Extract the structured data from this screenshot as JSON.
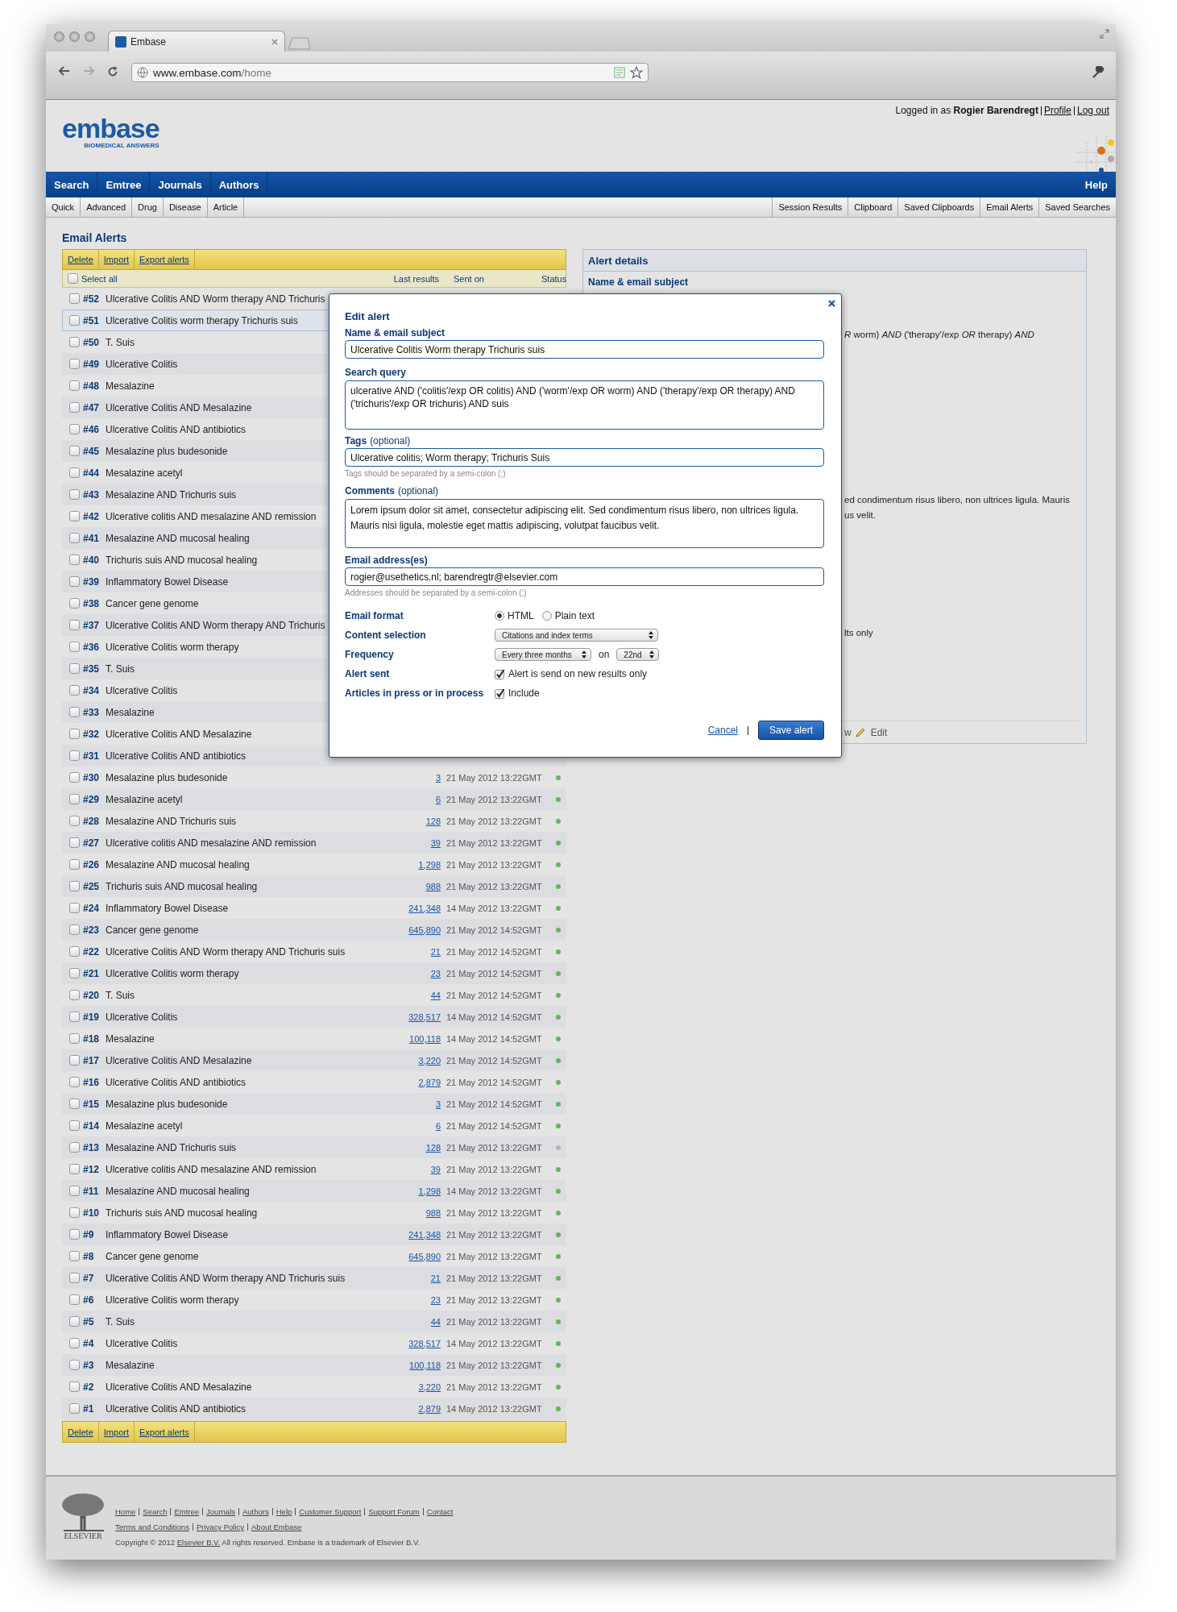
{
  "browser": {
    "tab_title": "Embase",
    "url_host": "www.embase.com",
    "url_path": "/home"
  },
  "header": {
    "logo": "embase",
    "tagline": "BIOMEDICAL ANSWERS",
    "login_text": "Logged in as **Rogier Barendregt**",
    "user_links": [
      "Profile",
      "Log out"
    ]
  },
  "nav": {
    "items": [
      "Search",
      "Emtree",
      "Journals",
      "Authors"
    ],
    "help": "Help"
  },
  "subnav": {
    "left": [
      "Quick",
      "Advanced",
      "Drug",
      "Disease",
      "Article"
    ],
    "right": [
      "Session Results",
      "Clipboard",
      "Saved Clipboards",
      "Email Alerts",
      "Saved Searches"
    ]
  },
  "page_title": "Email Alerts",
  "toolbar": [
    "Delete",
    "Import",
    "Export alerts"
  ],
  "list_header": {
    "select_all": "Select all",
    "checked": false,
    "columns": [
      "Last results",
      "Sent on",
      "Status"
    ]
  },
  "alerts": [
    {
      "num": "#52",
      "title": "Ulcerative Colitis AND Worm therapy AND Trichuris",
      "selected": false
    },
    {
      "num": "#51",
      "title": "Ulcerative Colitis worm therapy Trichuris suis",
      "selected": true
    },
    {
      "num": "#50",
      "title": "T. Suis",
      "selected": false
    },
    {
      "num": "#49",
      "title": "Ulcerative Colitis",
      "selected": false
    },
    {
      "num": "#48",
      "title": "Mesalazine",
      "selected": false
    },
    {
      "num": "#47",
      "title": "Ulcerative Colitis AND Mesalazine",
      "selected": false
    },
    {
      "num": "#46",
      "title": "Ulcerative Colitis AND antibiotics",
      "selected": false
    },
    {
      "num": "#45",
      "title": "Mesalazine plus budesonide",
      "selected": false
    },
    {
      "num": "#44",
      "title": "Mesalazine acetyl",
      "selected": false
    },
    {
      "num": "#43",
      "title": "Mesalazine AND Trichuris suis",
      "selected": false
    },
    {
      "num": "#42",
      "title": "Ulcerative colitis AND mesalazine AND remission",
      "selected": false
    },
    {
      "num": "#41",
      "title": "Mesalazine AND mucosal healing",
      "selected": false
    },
    {
      "num": "#40",
      "title": "Trichuris suis AND mucosal healing",
      "selected": false
    },
    {
      "num": "#39",
      "title": "Inflammatory Bowel Disease",
      "selected": false
    },
    {
      "num": "#38",
      "title": "Cancer gene genome",
      "selected": false
    },
    {
      "num": "#37",
      "title": "Ulcerative Colitis AND Worm therapy AND Trichuris",
      "selected": false
    },
    {
      "num": "#36",
      "title": "Ulcerative Colitis worm therapy",
      "selected": false
    },
    {
      "num": "#35",
      "title": "T. Suis",
      "selected": false
    },
    {
      "num": "#34",
      "title": "Ulcerative Colitis",
      "selected": false
    },
    {
      "num": "#33",
      "title": "Mesalazine",
      "selected": false
    },
    {
      "num": "#32",
      "title": "Ulcerative Colitis AND Mesalazine",
      "selected": false
    },
    {
      "num": "#31",
      "title": "Ulcerative Colitis AND antibiotics",
      "selected": false
    },
    {
      "num": "#30",
      "title": "Mesalazine plus budesonide",
      "selected": false,
      "results": "3",
      "sent": "21 May 2012 13:22GMT",
      "active": true
    },
    {
      "num": "#29",
      "title": "Mesalazine acetyl",
      "selected": false,
      "results": "6",
      "sent": "21 May 2012 13:22GMT",
      "active": true
    },
    {
      "num": "#28",
      "title": "Mesalazine AND Trichuris suis",
      "selected": false,
      "results": "128",
      "sent": "21 May 2012 13:22GMT",
      "active": true
    },
    {
      "num": "#27",
      "title": "Ulcerative colitis AND mesalazine AND remission",
      "selected": false,
      "results": "39",
      "sent": "21 May 2012 13:22GMT",
      "active": true
    },
    {
      "num": "#26",
      "title": "Mesalazine AND mucosal healing",
      "selected": false,
      "results": "1,298",
      "sent": "21 May 2012 13:22GMT",
      "active": true
    },
    {
      "num": "#25",
      "title": "Trichuris suis AND mucosal healing",
      "selected": false,
      "results": "988",
      "sent": "21 May 2012 13:22GMT",
      "active": true
    },
    {
      "num": "#24",
      "title": "Inflammatory Bowel Disease",
      "selected": false,
      "results": "241,348",
      "sent": "14 May 2012 13:22GMT",
      "active": true
    },
    {
      "num": "#23",
      "title": "Cancer gene genome",
      "selected": false,
      "results": "645,890",
      "sent": "21 May 2012 14:52GMT",
      "active": true
    },
    {
      "num": "#22",
      "title": "Ulcerative Colitis AND Worm therapy AND Trichuris suis",
      "selected": false,
      "results": "21",
      "sent": "21 May 2012 14:52GMT",
      "active": true
    },
    {
      "num": "#21",
      "title": "Ulcerative Colitis worm therapy",
      "selected": false,
      "results": "23",
      "sent": "21 May 2012 14:52GMT",
      "active": true
    },
    {
      "num": "#20",
      "title": "T. Suis",
      "selected": false,
      "results": "44",
      "sent": "21 May 2012 14:52GMT",
      "active": true
    },
    {
      "num": "#19",
      "title": "Ulcerative Colitis",
      "selected": false,
      "results": "328,517",
      "sent": "14 May 2012 14:52GMT",
      "active": true
    },
    {
      "num": "#18",
      "title": "Mesalazine",
      "selected": false,
      "results": "100,118",
      "sent": "14 May 2012 14:52GMT",
      "active": true
    },
    {
      "num": "#17",
      "title": "Ulcerative Colitis AND Mesalazine",
      "selected": false,
      "results": "3,220",
      "sent": "21 May 2012 14:52GMT",
      "active": true
    },
    {
      "num": "#16",
      "title": "Ulcerative Colitis AND antibiotics",
      "selected": false,
      "results": "2,879",
      "sent": "21 May 2012 14:52GMT",
      "active": true
    },
    {
      "num": "#15",
      "title": "Mesalazine plus budesonide",
      "selected": false,
      "results": "3",
      "sent": "21 May 2012 14:52GMT",
      "active": true
    },
    {
      "num": "#14",
      "title": "Mesalazine acetyl",
      "selected": false,
      "results": "6",
      "sent": "21 May 2012 14:52GMT",
      "active": true
    },
    {
      "num": "#13",
      "title": "Mesalazine AND Trichuris suis",
      "selected": false,
      "results": "128",
      "sent": "21 May 2012 13:22GMT",
      "active": false
    },
    {
      "num": "#12",
      "title": "Ulcerative colitis AND mesalazine AND remission",
      "selected": false,
      "results": "39",
      "sent": "21 May 2012 13:22GMT",
      "active": true
    },
    {
      "num": "#11",
      "title": "Mesalazine AND mucosal healing",
      "selected": false,
      "results": "1,298",
      "sent": "14 May 2012 13:22GMT",
      "active": true
    },
    {
      "num": "#10",
      "title": "Trichuris suis AND mucosal healing",
      "selected": false,
      "results": "988",
      "sent": "21 May 2012 13:22GMT",
      "active": true
    },
    {
      "num": "#9",
      "title": "Inflammatory Bowel Disease",
      "selected": false,
      "results": "241,348",
      "sent": "21 May 2012 13:22GMT",
      "active": true
    },
    {
      "num": "#8",
      "title": "Cancer gene genome",
      "selected": false,
      "results": "645,890",
      "sent": "21 May 2012 13:22GMT",
      "active": true
    },
    {
      "num": "#7",
      "title": "Ulcerative Colitis AND Worm therapy AND Trichuris suis",
      "selected": false,
      "results": "21",
      "sent": "21 May 2012 13:22GMT",
      "active": true
    },
    {
      "num": "#6",
      "title": "Ulcerative Colitis worm therapy",
      "selected": false,
      "results": "23",
      "sent": "21 May 2012 13:22GMT",
      "active": true
    },
    {
      "num": "#5",
      "title": "T. Suis",
      "selected": false,
      "results": "44",
      "sent": "21 May 2012 13:22GMT",
      "active": true
    },
    {
      "num": "#4",
      "title": "Ulcerative Colitis",
      "selected": false,
      "results": "328,517",
      "sent": "14 May 2012 13:22GMT",
      "active": true
    },
    {
      "num": "#3",
      "title": "Mesalazine",
      "selected": false,
      "results": "100,118",
      "sent": "21 May 2012 13:22GMT",
      "active": true
    },
    {
      "num": "#2",
      "title": "Ulcerative Colitis AND Mesalazine",
      "selected": false,
      "results": "3,220",
      "sent": "21 May 2012 13:22GMT",
      "active": true
    },
    {
      "num": "#1",
      "title": "Ulcerative Colitis AND antibiotics",
      "selected": false,
      "results": "2,879",
      "sent": "14 May 2012 13:22GMT",
      "active": true
    }
  ],
  "bottom_toolbar": [
    "Delete",
    "Import",
    "Export alerts"
  ],
  "details": {
    "title": "Alert details",
    "name_label": "Name & email subject",
    "query_fragment": "*R* worm) *AND* ('therapy'/exp *OR* therapy) *AND*",
    "comment_fragments": [
      "ed condimentum risus libero, non ultrices ligula. Mauris",
      "us velit."
    ],
    "alert_fragment": "lts only",
    "preview_fragment": "w",
    "edit_link": "Edit"
  },
  "modal": {
    "title": "Edit alert",
    "fields": [
      {
        "label": "Name & email subject",
        "kind": "input",
        "value": "Ulcerative Colitis Worm therapy Trichuris suis"
      },
      {
        "label": "Search query",
        "kind": "textarea",
        "value": "ulcerative AND ('colitis'/exp OR colitis) AND ('worm'/exp OR worm) AND ('therapy'/exp OR therapy) AND ('trichuris'/exp OR trichuris) AND suis"
      },
      {
        "label": "Tags",
        "optional": "(optional)",
        "kind": "input",
        "value": "Ulcerative colitis; Worm therapy; Trichuris Suis",
        "help": "Tags should be separated by a semi-colon (;)"
      },
      {
        "label": "Comments",
        "optional": "(optional)",
        "kind": "textarea",
        "value": "Lorem ipsum dolor sit amet, consectetur adipiscing elit. Sed condimentum risus libero, non ultrices ligula. Mauris nisi ligula, molestie eget mattis adipiscing, volutpat faucibus velit."
      },
      {
        "label": "Email address(es)",
        "kind": "input",
        "value": "rogier@usethetics.nl; barendregtr@elsevier.com",
        "help": "Addresses should be separated by a semi-colon (;)"
      }
    ],
    "settings": [
      {
        "label": "Email format",
        "kind": "radio",
        "options": [
          {
            "label": "HTML",
            "selected": true
          },
          {
            "label": "Plain text",
            "selected": false
          }
        ]
      },
      {
        "label": "Content selection",
        "kind": "select",
        "value": "Citations and index terms"
      },
      {
        "label": "Frequency",
        "kind": "select",
        "value": "Every three months",
        "joiner": "on",
        "value2": "22nd"
      },
      {
        "label": "Alert sent",
        "kind": "checkbox",
        "checked": true,
        "text": "Alert is send on new results only"
      },
      {
        "label": "Articles in press or in process",
        "kind": "checkbox",
        "checked": true,
        "text": "Include"
      }
    ],
    "cancel": "Cancel",
    "save": "Save alert"
  },
  "footer": {
    "links": [
      [
        "Home",
        "Search",
        "Emtree",
        "Journals",
        "Authors",
        "Help",
        "Customer Support",
        "Support Forum",
        "Contact"
      ],
      [
        "Terms and Conditions",
        "Privacy Policy",
        "About Embase"
      ]
    ],
    "copyright_before": "Copyright © 2012",
    "copyright_link": "Elsevier B.V.",
    "copyright_after": "All rights reserved. Embase is a trademark of Elsevier B.V.",
    "publisher": "ELSEVIER"
  }
}
